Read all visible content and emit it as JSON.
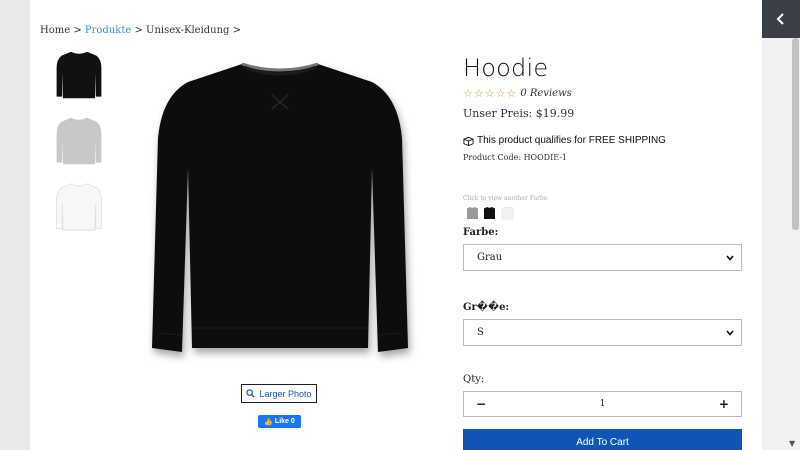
{
  "breadcrumb": {
    "home": "Home",
    "sep1": " > ",
    "products": "Produkte",
    "sep2": " > ",
    "category": "Unisex-Kleidung",
    "sep3": " >"
  },
  "gallery": {
    "thumbnails": [
      {
        "color_name": "black",
        "color": "#111111"
      },
      {
        "color_name": "grey",
        "color": "#c8c8c8"
      },
      {
        "color_name": "white",
        "color": "#f6f6f6"
      }
    ],
    "main_photo_color": "#0e0e0e",
    "larger_photo_label": "Larger Photo",
    "fb_like_label": "Like 0"
  },
  "product": {
    "title": "Hoodie",
    "stars": "☆☆☆☆☆",
    "reviews": "0 Reviews",
    "price": "Unser Preis: $19.99",
    "shipping": "This product qualifies for FREE SHIPPING",
    "code": "Product Code: HOODIE-1"
  },
  "swatches": {
    "hint": "Click to view another Farbe",
    "colors": [
      "#9a9a9a",
      "#111111",
      "#f3f3f3"
    ]
  },
  "options": {
    "color_label": "Farbe:",
    "color_value": "Grau",
    "size_label": "Gr��e:",
    "size_value": "S",
    "qty_label": "Qty:",
    "qty_value": "1",
    "minus": "−",
    "plus": "+"
  },
  "cart": {
    "add_label": "Add To Cart",
    "accent": "#0e55b5"
  }
}
